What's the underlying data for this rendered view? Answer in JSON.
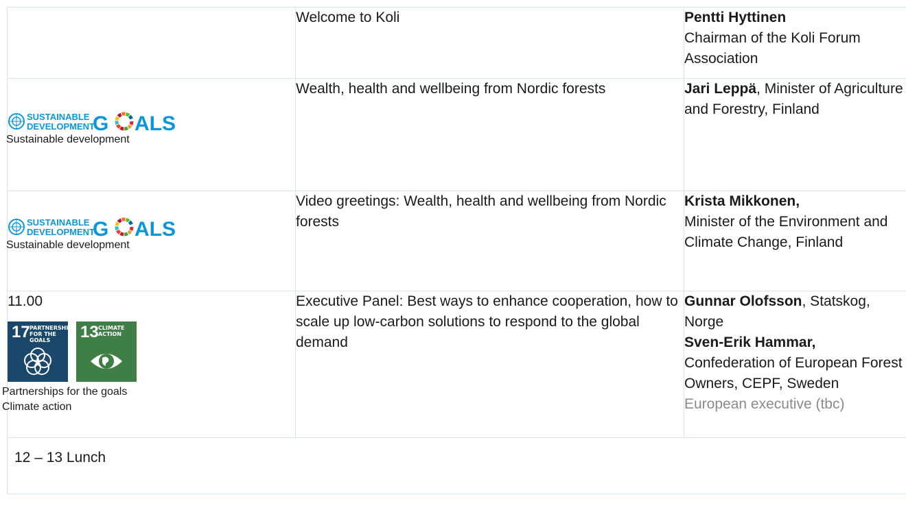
{
  "rows": [
    {
      "left": {},
      "title": "Welcome to Koli",
      "speaker": {
        "bold": "Pentti Hyttinen",
        "rest": "Chairman of the Koli Forum Association"
      }
    },
    {
      "left": {
        "logo_text": "SUSTAINABLE DEVELOPMENT GOALS",
        "caption": "Sustainable development"
      },
      "title": "Wealth, health and wellbeing from Nordic forests",
      "speaker": {
        "bold": "Jari Leppä",
        "rest": ", Minister of Agriculture and Forestry, Finland"
      }
    },
    {
      "left": {
        "logo_text": "SUSTAINABLE DEVELOPMENT GOALS",
        "caption": "Sustainable development"
      },
      "title": "Video greetings: Wealth, health and wellbeing from Nordic forests",
      "speaker": {
        "bold": "Krista Mikkonen,",
        "rest": "Minister of the Environment and Climate Change, Finland"
      }
    },
    {
      "left": {
        "time": "11.00",
        "tiles": [
          {
            "number": "17",
            "label_line1": "PARTNERSHIPS",
            "label_line2": "FOR THE GOALS",
            "color": "#19486a",
            "icon": "rings-icon"
          },
          {
            "number": "13",
            "label_line1": "CLIMATE",
            "label_line2": "ACTION",
            "color": "#3f7e44",
            "icon": "eye-globe-icon"
          }
        ],
        "caption_line1": "Partnerships for the goals",
        "caption_line2": "Climate action"
      },
      "title": "Executive Panel: Best ways to enhance cooperation, how to scale up low-carbon solutions to respond to the global demand",
      "speakers": [
        {
          "bold": "Gunnar Olofsson",
          "rest": ", Statskog, Norge"
        },
        {
          "bold": "Sven-Erik Hammar,",
          "rest": "Confederation of European Forest Owners, CEPF, Sweden"
        }
      ],
      "speaker_note": "European executive (tbc)"
    }
  ],
  "lunch": "12 – 13 Lunch",
  "colors": {
    "border": "#d6e3f1",
    "sdg_blue": "#0a97d9",
    "note_gray": "#8a8a8a"
  }
}
